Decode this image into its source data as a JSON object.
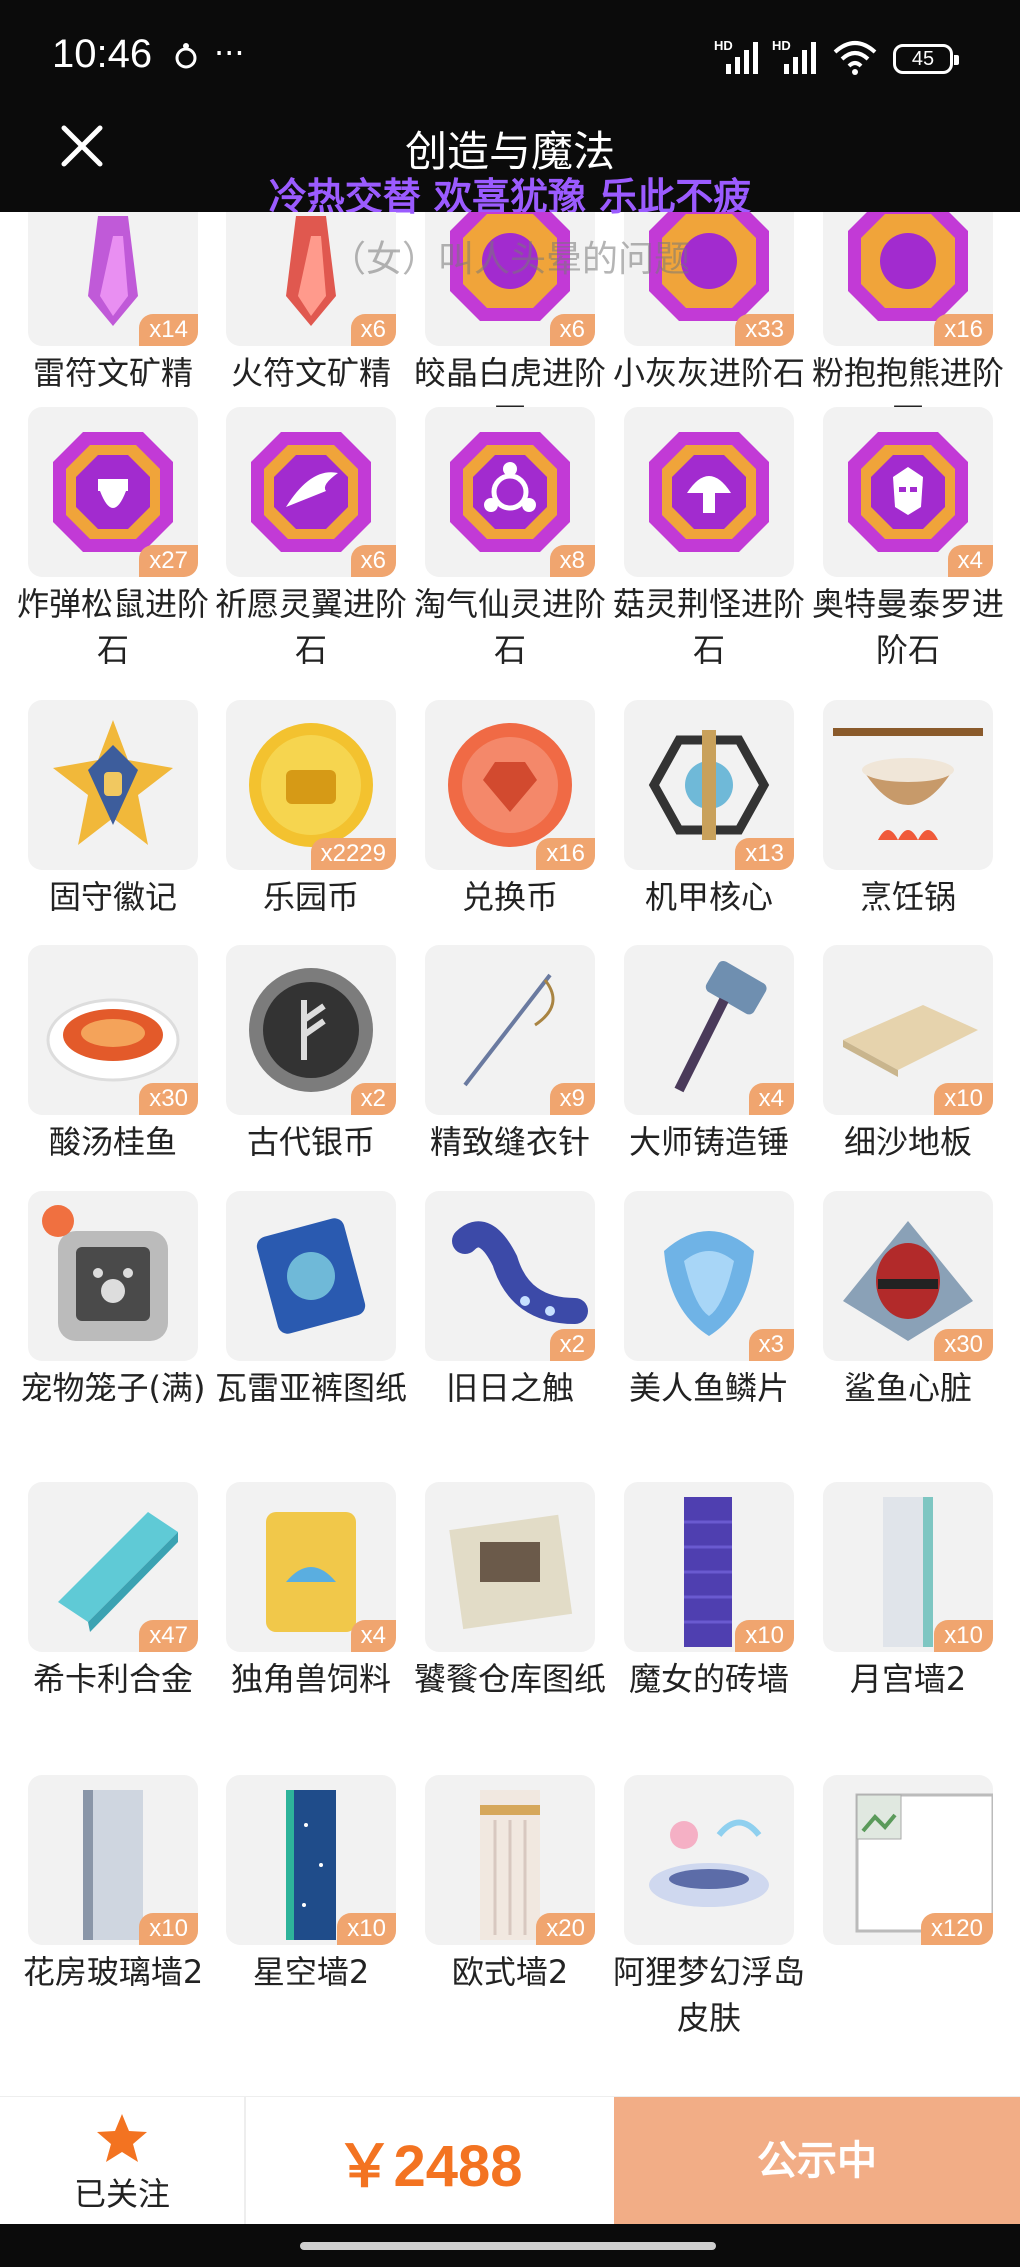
{
  "status_bar": {
    "time": "10:46",
    "dots": "···",
    "hd": "HD",
    "battery": "45"
  },
  "header": {
    "title": "创造与魔法",
    "subtitle": "冷热交替 欢喜犹豫 乐此不疲",
    "overlay": "（女）叫人头晕的问题"
  },
  "colors": {
    "accent": "#f37321",
    "badge": "#f0a56f",
    "publish_bg": "#f2ad86",
    "subtitle": "#9b5bff"
  },
  "rows": [
    [
      {
        "name": "雷符文矿精",
        "qty": "x14",
        "icon": "purple-crystal-icon"
      },
      {
        "name": "火符文矿精",
        "qty": "x6",
        "icon": "red-crystal-icon"
      },
      {
        "name": "皎晶白虎进阶石",
        "qty": "x6",
        "icon": "evolution-stone-icon"
      },
      {
        "name": "小灰灰进阶石",
        "qty": "x33",
        "icon": "evolution-stone-icon"
      },
      {
        "name": "粉抱抱熊进阶石",
        "qty": "x16",
        "icon": "evolution-stone-icon"
      }
    ],
    [
      {
        "name": "炸弹松鼠进阶石",
        "qty": "x27",
        "icon": "acorn-stone-icon"
      },
      {
        "name": "祈愿灵翼进阶石",
        "qty": "x6",
        "icon": "wing-stone-icon"
      },
      {
        "name": "淘气仙灵进阶石",
        "qty": "x8",
        "icon": "fairy-stone-icon"
      },
      {
        "name": "菇灵荆怪进阶石",
        "qty": "",
        "icon": "mushroom-stone-icon"
      },
      {
        "name": "奥特曼泰罗进阶石",
        "qty": "x4",
        "icon": "hero-stone-icon"
      }
    ],
    [
      {
        "name": "固守徽记",
        "qty": "",
        "icon": "shield-emblem-icon"
      },
      {
        "name": "乐园币",
        "qty": "x2229",
        "icon": "gold-coin-icon"
      },
      {
        "name": "兑换币",
        "qty": "x16",
        "icon": "exchange-coin-icon"
      },
      {
        "name": "机甲核心",
        "qty": "x13",
        "icon": "mech-core-icon"
      },
      {
        "name": "烹饪锅",
        "qty": "",
        "icon": "cooking-pot-icon"
      }
    ],
    [
      {
        "name": "酸汤桂鱼",
        "qty": "x30",
        "icon": "fish-dish-icon"
      },
      {
        "name": "古代银币",
        "qty": "x2",
        "icon": "silver-coin-icon"
      },
      {
        "name": "精致缝衣针",
        "qty": "x9",
        "icon": "needle-icon"
      },
      {
        "name": "大师铸造锤",
        "qty": "x4",
        "icon": "hammer-icon"
      },
      {
        "name": "细沙地板",
        "qty": "x10",
        "icon": "sand-floor-icon"
      }
    ],
    [
      {
        "name": "宠物笼子(满)",
        "qty": "",
        "icon": "pet-cage-icon"
      },
      {
        "name": "瓦雷亚裤图纸",
        "qty": "",
        "icon": "blueprint-scroll-icon"
      },
      {
        "name": "旧日之触",
        "qty": "x2",
        "icon": "tentacle-icon"
      },
      {
        "name": "美人鱼鳞片",
        "qty": "x3",
        "icon": "mermaid-scale-icon"
      },
      {
        "name": "鲨鱼心脏",
        "qty": "x30",
        "icon": "shark-heart-icon"
      }
    ],
    [
      {
        "name": "希卡利合金",
        "qty": "x47",
        "icon": "alloy-bar-icon"
      },
      {
        "name": "独角兽饲料",
        "qty": "x4",
        "icon": "feed-bag-icon"
      },
      {
        "name": "饕餮仓库图纸",
        "qty": "",
        "icon": "warehouse-blueprint-icon"
      },
      {
        "name": "魔女的砖墙",
        "qty": "x10",
        "icon": "brick-wall-icon"
      },
      {
        "name": "月宫墙2",
        "qty": "x10",
        "icon": "white-wall-icon"
      }
    ],
    [
      {
        "name": "花房玻璃墙2",
        "qty": "x10",
        "icon": "glass-wall-icon"
      },
      {
        "name": "星空墙2",
        "qty": "x10",
        "icon": "starry-wall-icon"
      },
      {
        "name": "欧式墙2",
        "qty": "x20",
        "icon": "european-wall-icon"
      },
      {
        "name": "阿狸梦幻浮岛皮肤",
        "qty": "",
        "icon": "floating-island-icon"
      },
      {
        "name": "",
        "qty": "x120",
        "icon": "broken-image-icon"
      }
    ]
  ],
  "bottom_bar": {
    "follow_label": "已关注",
    "price": "￥2488",
    "publish_label": "公示中"
  }
}
